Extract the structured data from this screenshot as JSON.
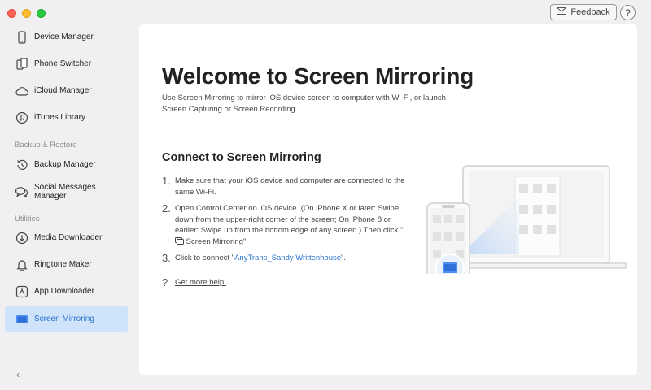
{
  "header": {
    "feedback_label": "Feedback",
    "help_label": "?"
  },
  "sidebar": {
    "items": [
      {
        "label": "Device Manager",
        "icon": "device-icon"
      },
      {
        "label": "Phone Switcher",
        "icon": "phone-icon"
      },
      {
        "label": "iCloud Manager",
        "icon": "cloud-icon"
      },
      {
        "label": "iTunes Library",
        "icon": "music-icon"
      }
    ],
    "section_backup": "Backup & Restore",
    "backup_items": [
      {
        "label": "Backup Manager",
        "icon": "history-icon"
      },
      {
        "label": "Social Messages Manager",
        "icon": "chat-icon"
      }
    ],
    "section_utilities": "Utilities",
    "utility_items": [
      {
        "label": "Media Downloader",
        "icon": "download-icon"
      },
      {
        "label": "Ringtone Maker",
        "icon": "bell-icon"
      },
      {
        "label": "App Downloader",
        "icon": "app-store-icon"
      },
      {
        "label": "Screen Mirroring",
        "icon": "screen-mirroring-icon",
        "active": true
      }
    ],
    "collapse_label": "‹"
  },
  "main": {
    "title": "Welcome to Screen Mirroring",
    "description": "Use Screen Mirroring to mirror iOS device screen to computer with Wi-Fi, or launch Screen Capturing or Screen Recording.",
    "section_title": "Connect to Screen Mirroring",
    "steps": [
      {
        "num": "1.",
        "text": "Make sure that your iOS device and computer are connected to the same Wi-Fi."
      },
      {
        "num": "2.",
        "text_before": "Open Control Center on iOS device. (On iPhone X or later: Swipe down from the upper-right corner of the screen; On iPhone 8 or earlier: Swipe up from the bottom edge of any screen.) Then click \"",
        "text_after": " Screen Mirroring\"."
      },
      {
        "num": "3.",
        "text_before": "Click to connect \"",
        "link": "AnyTrans_Sandy Writtenhouse",
        "text_after": "\"."
      }
    ],
    "more_help": "Get more help.",
    "more_help_icon": "?"
  },
  "colors": {
    "accent": "#2b74d0",
    "active_bg": "#cfe3fa"
  }
}
